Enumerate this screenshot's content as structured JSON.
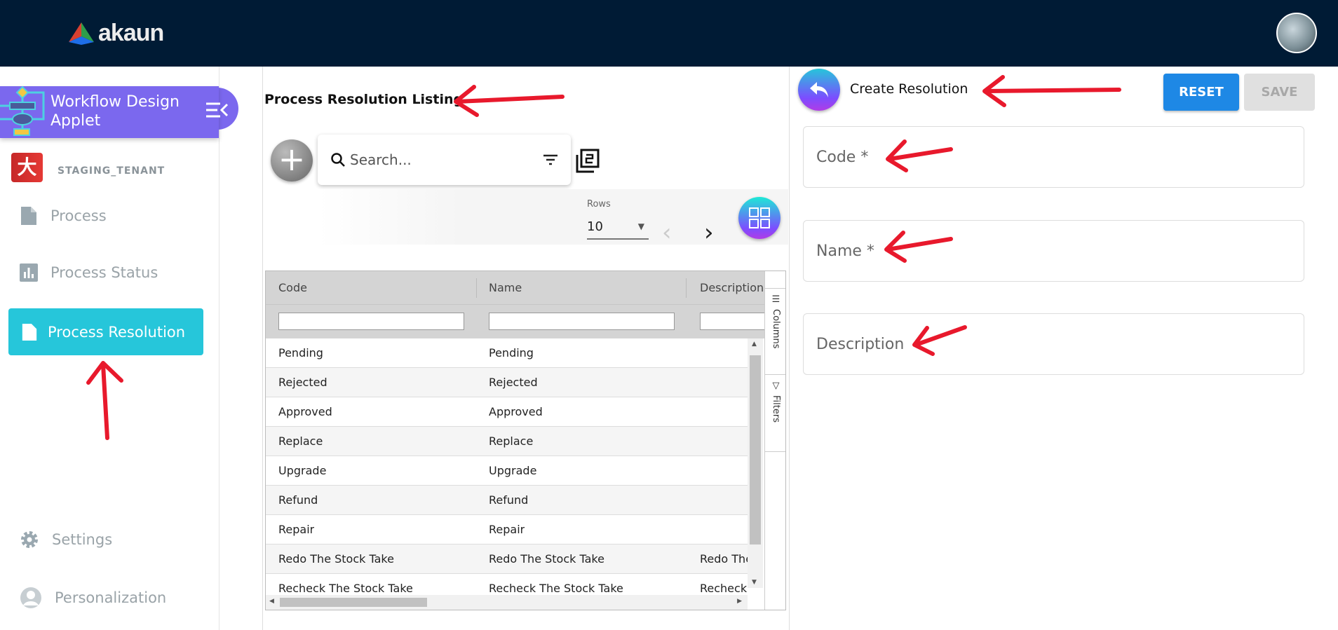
{
  "header": {
    "logo_text": "akaun",
    "avatar_alt": "user avatar"
  },
  "sidebar": {
    "applet_name": "Workflow Design Applet",
    "tenant": "STAGING_TENANT",
    "items": [
      {
        "label": "Process",
        "icon": "file-icon"
      },
      {
        "label": "Process Status",
        "icon": "bar-chart-icon"
      },
      {
        "label": "Process Resolution",
        "icon": "file-icon",
        "active": true
      }
    ],
    "bottom_items": [
      {
        "label": "Settings",
        "icon": "gear-icon"
      },
      {
        "label": "Personalization",
        "icon": "person-icon"
      }
    ],
    "active_color": "#26c6da",
    "applet_color": "#7b68ee"
  },
  "listing": {
    "title": "Process Resolution Listing",
    "search_placeholder": "Search...",
    "rows_label": "Rows",
    "rows_value": "10",
    "columns": [
      "Code",
      "Name",
      "Description"
    ],
    "side_tabs": [
      "Columns",
      "Filters"
    ],
    "rows": [
      [
        "Pending",
        "Pending",
        ""
      ],
      [
        "Rejected",
        "Rejected",
        ""
      ],
      [
        "Approved",
        "Approved",
        ""
      ],
      [
        "Replace",
        "Replace",
        ""
      ],
      [
        "Upgrade",
        "Upgrade",
        ""
      ],
      [
        "Refund",
        "Refund",
        ""
      ],
      [
        "Repair",
        "Repair",
        ""
      ],
      [
        "Redo The Stock Take",
        "Redo The Stock Take",
        "Redo The"
      ],
      [
        "Recheck The Stock Take",
        "Recheck The Stock Take",
        "Recheck"
      ]
    ]
  },
  "form": {
    "title": "Create Resolution",
    "reset_label": "RESET",
    "save_label": "SAVE",
    "fields": [
      {
        "label": "Code *"
      },
      {
        "label": "Name *"
      },
      {
        "label": "Description"
      }
    ]
  },
  "annotation_color": "#e8192c"
}
